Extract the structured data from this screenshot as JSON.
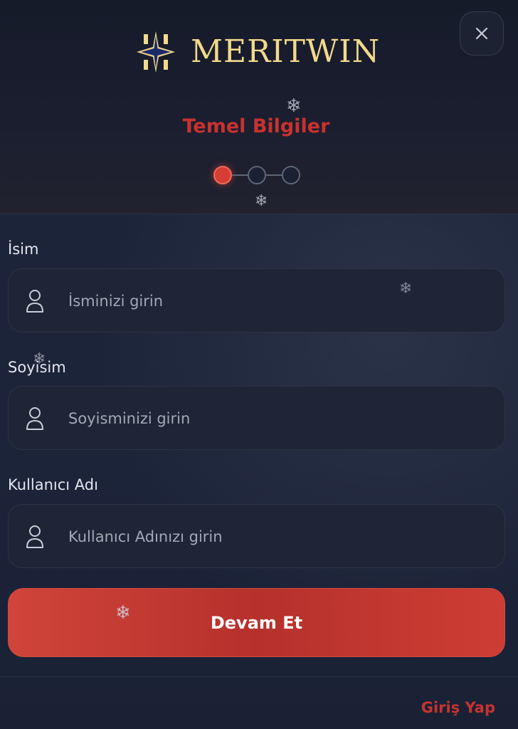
{
  "brand": {
    "logo_text": "MERITWIN"
  },
  "header": {
    "close_icon": "close-icon",
    "step_title": "Temel Bilgiler",
    "steps": [
      {
        "state": "active"
      },
      {
        "state": "inactive"
      },
      {
        "state": "inactive"
      }
    ]
  },
  "form": {
    "fields": [
      {
        "label": "İsim",
        "placeholder": "İsminizi girin",
        "value": "",
        "icon": "user-icon"
      },
      {
        "label": "Soyisim",
        "placeholder": "Soyisminizi girin",
        "value": "",
        "icon": "user-icon"
      },
      {
        "label": "Kullanıcı Adı",
        "placeholder": "Kullanıcı Adınızı girin",
        "value": "",
        "icon": "user-icon"
      }
    ],
    "submit_label": "Devam Et"
  },
  "footer": {
    "login_link": "Giriş Yap"
  },
  "decorations": {
    "snowflake_glyph": "❄",
    "snowflake_icon": "snowflake-icon"
  },
  "colors": {
    "accent_red": "#c8322e",
    "button_red": "#c23a32",
    "logo_gold": "#f2d98c",
    "logo_navy": "#1b2a6b",
    "background": "#1b2338"
  }
}
